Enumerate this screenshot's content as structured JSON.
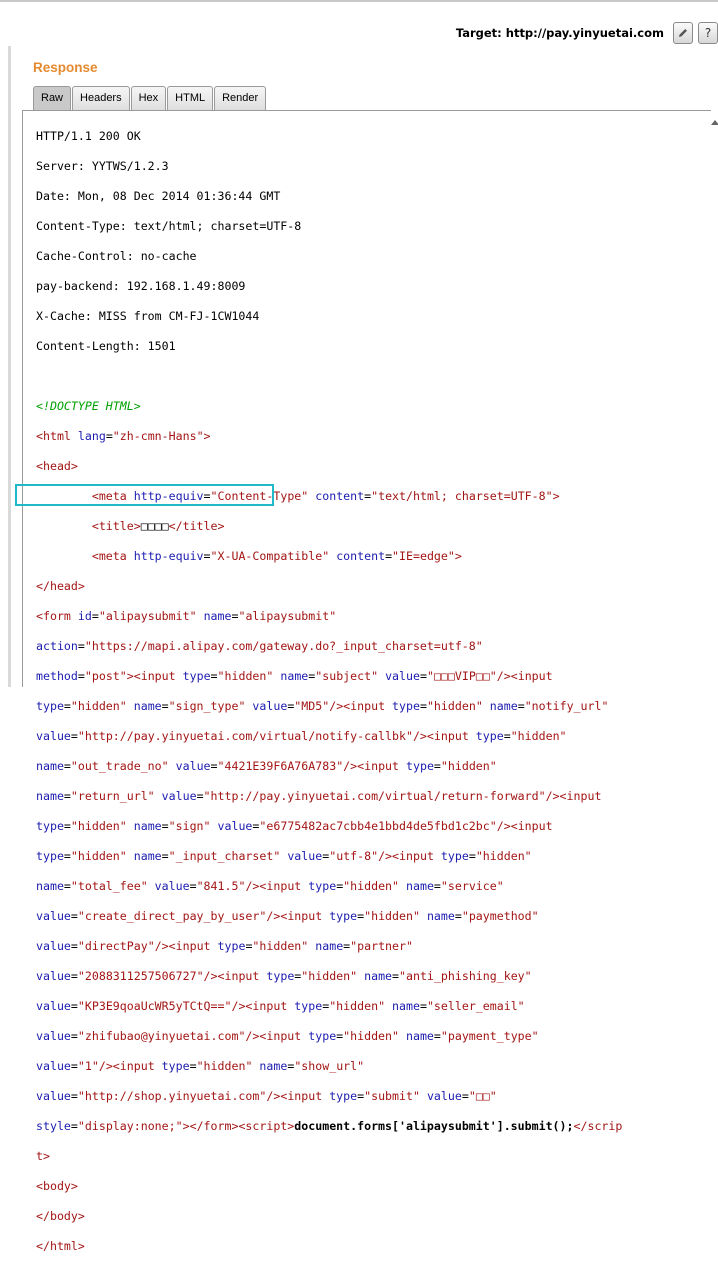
{
  "topbar": {
    "target_label": "Target: http://pay.yinyuetai.com",
    "edit_icon": "pencil-icon",
    "help_label": "?"
  },
  "panel": {
    "title": "Response",
    "tabs": [
      "Raw",
      "Headers",
      "Hex",
      "HTML",
      "Render"
    ],
    "active_tab": "Raw"
  },
  "response": {
    "headers": [
      "HTTP/1.1 200 OK",
      "Server: YYTWS/1.2.3",
      "Date: Mon, 08 Dec 2014 01:36:44 GMT",
      "Content-Type: text/html; charset=UTF-8",
      "Cache-Control: no-cache",
      "pay-backend: 192.168.1.49:8009",
      "X-Cache: MISS from CM-FJ-1CW1044",
      "Content-Length: 1501"
    ],
    "doctype": "<!DOCTYPE HTML>",
    "html_open": {
      "tag": "html",
      "attr": "lang",
      "value": "zh-cmn-Hans"
    },
    "head_open": "<head>",
    "meta1": {
      "attr1": "http-equiv",
      "val1": "Content-Type",
      "attr2": "content",
      "val2": "text/html; charset=UTF-8"
    },
    "title_text": "□□□□",
    "meta2": {
      "attr1": "http-equiv",
      "val1": "X-UA-Compatible",
      "attr2": "content",
      "val2": "IE=edge"
    },
    "head_close": "</head>",
    "form": {
      "id": "alipaysubmit",
      "name": "alipaysubmit",
      "action": "https://mapi.alipay.com/gateway.do?_input_charset=utf-8",
      "method": "post",
      "subject": "□□□VIP□□",
      "sign_type": "MD5",
      "notify_url": "http://pay.yinyuetai.com/virtual/notify-callbk",
      "out_trade_no": "4421E39F6A76A783",
      "return_url": "http://pay.yinyuetai.com/virtual/return-forward",
      "sign": "e6775482ac7cbb4e1bbd4de5fbd1c2bc",
      "input_charset": "utf-8",
      "total_fee": "841.5",
      "service": "create_direct_pay_by_user",
      "paymethod": "directPay",
      "partner": "2088311257506727",
      "anti_phishing_key": "KP3E9qoaUcWR5yTCtQ==",
      "seller_email": "zhifubao@yinyuetai.com",
      "payment_type": "1",
      "show_url": "http://shop.yinyuetai.com",
      "submit_value": "□□",
      "submit_style": "display:none;",
      "script": "document.forms['alipaysubmit'].submit();"
    },
    "body_open": "<body>",
    "body_close": "</body>",
    "html_close": "</html>"
  },
  "colors": {
    "accent": "#e58a2e",
    "tag": "#a31515",
    "attribute": "#1c1cb0",
    "comment": "#00a000",
    "highlight_box": "#1fb9c8"
  }
}
